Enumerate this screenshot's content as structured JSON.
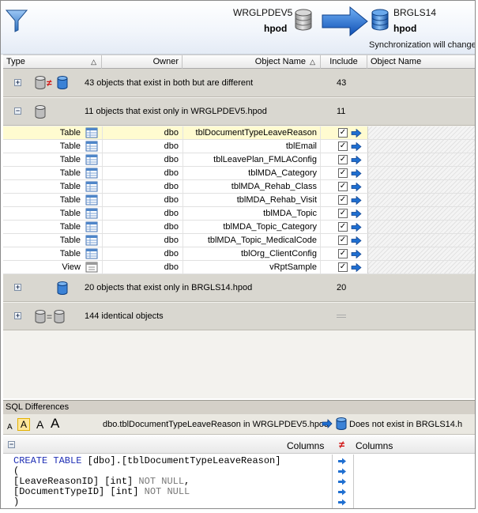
{
  "header": {
    "source_server": "WRGLPDEV5",
    "source_db": "hpod",
    "target_server": "BRGLS14",
    "target_db": "hpod",
    "note": "Synchronization will change"
  },
  "columns": {
    "type": "Type",
    "owner": "Owner",
    "object_name": "Object Name",
    "include": "Include",
    "object_name_right": "Object Name"
  },
  "groups": [
    {
      "label": "43 objects that exist in both but are different",
      "count": "43",
      "expander": "+"
    },
    {
      "label": "11 objects that exist only in WRGLPDEV5.hpod",
      "count": "11",
      "expander": "−"
    },
    {
      "label": "20 objects that exist only in BRGLS14.hpod",
      "count": "20",
      "expander": "+"
    },
    {
      "label": "144 identical objects",
      "count": "",
      "expander": "+"
    }
  ],
  "rows": [
    {
      "type": "Table",
      "owner": "dbo",
      "name": "tblDocumentTypeLeaveReason",
      "include": "✓"
    },
    {
      "type": "Table",
      "owner": "dbo",
      "name": "tblEmail",
      "include": "✓"
    },
    {
      "type": "Table",
      "owner": "dbo",
      "name": "tblLeavePlan_FMLAConfig",
      "include": "✓"
    },
    {
      "type": "Table",
      "owner": "dbo",
      "name": "tblMDA_Category",
      "include": "✓"
    },
    {
      "type": "Table",
      "owner": "dbo",
      "name": "tblMDA_Rehab_Class",
      "include": "✓"
    },
    {
      "type": "Table",
      "owner": "dbo",
      "name": "tblMDA_Rehab_Visit",
      "include": "✓"
    },
    {
      "type": "Table",
      "owner": "dbo",
      "name": "tblMDA_Topic",
      "include": "✓"
    },
    {
      "type": "Table",
      "owner": "dbo",
      "name": "tblMDA_Topic_Category",
      "include": "✓"
    },
    {
      "type": "Table",
      "owner": "dbo",
      "name": "tblMDA_Topic_MedicalCode",
      "include": "✓"
    },
    {
      "type": "Table",
      "owner": "dbo",
      "name": "tblOrg_ClientConfig",
      "include": "✓"
    },
    {
      "type": "View",
      "owner": "dbo",
      "name": "vRptSample",
      "include": "✓"
    }
  ],
  "sql_diff": {
    "title": "SQL Differences",
    "font_sizes": [
      "A",
      "A",
      "A",
      "A"
    ],
    "left_object": "dbo.tblDocumentTypeLeaveReason in WRGLPDEV5.hpod",
    "right_object": "Does not exist in BRGLS14.h",
    "left_header": "Columns",
    "right_header": "Columns",
    "code": {
      "l1_kw": "CREATE TABLE",
      "l1_rest": " [dbo].[tblDocumentTypeLeaveReason]",
      "l2": "(",
      "l3_a": "[LeaveReasonID] [int]",
      "l3_b": " NOT NULL",
      "l3_c": ",",
      "l4_a": "[DocumentTypeID] [int]",
      "l4_b": " NOT NULL",
      "l5": ")"
    }
  },
  "colors": {
    "accent": "#1f6fd1",
    "highlight_row": "#fffbd0",
    "group_bg": "#d9d7d0",
    "diff_red": "#d01010",
    "keyword": "#1f2fb5"
  }
}
